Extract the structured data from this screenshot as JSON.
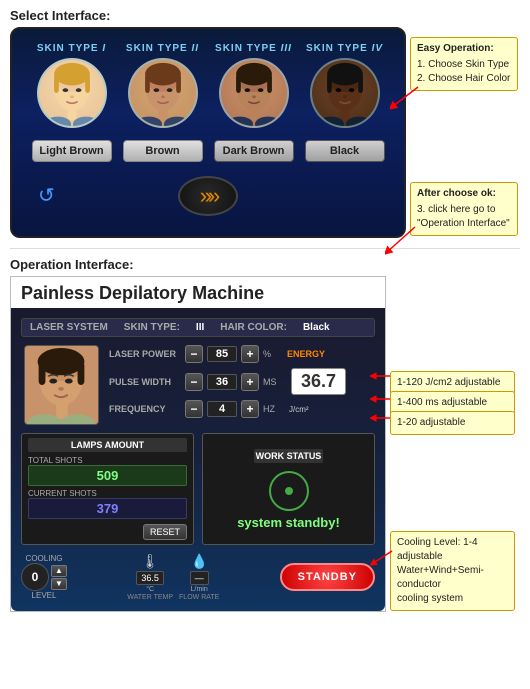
{
  "select_interface": {
    "label": "Select Interface:",
    "skin_types": [
      {
        "id": "I",
        "label": "SKIN TYPE",
        "numeral": "I",
        "face_tone": "light"
      },
      {
        "id": "II",
        "label": "SKIN TYPE",
        "numeral": "II",
        "face_tone": "medium-light"
      },
      {
        "id": "III",
        "label": "SKIN TYPE",
        "numeral": "III",
        "face_tone": "medium"
      },
      {
        "id": "IV",
        "label": "SKIN TYPE",
        "numeral": "IV",
        "face_tone": "dark"
      }
    ],
    "color_buttons": [
      {
        "id": "light-brown",
        "label": "Light Brown"
      },
      {
        "id": "brown",
        "label": "Brown"
      },
      {
        "id": "dark-brown",
        "label": "Dark Brown"
      },
      {
        "id": "black",
        "label": "Black"
      }
    ],
    "annotation_1": {
      "title": "Easy Operation:",
      "lines": [
        "1. Choose Skin Type",
        "2. Choose Hair Color"
      ]
    },
    "annotation_2": {
      "title": "After choose ok:",
      "lines": [
        "3. click here go to",
        "\"Operation Interface\""
      ]
    },
    "arrow_button": "»»"
  },
  "operation_interface": {
    "label": "Operation Interface:",
    "machine_title": "Painless Depilatory Machine",
    "header": {
      "laser_system": "LASER SYSTEM",
      "skin_type_label": "SKIN TYPE:",
      "skin_type_value": "III",
      "hair_color_label": "HAIR COLOR:",
      "hair_color_value": "Black"
    },
    "params": [
      {
        "label": "LASER POWER",
        "value": "85",
        "unit": "%"
      },
      {
        "label": "PULSE WIDTH",
        "value": "36",
        "unit": "MS"
      },
      {
        "label": "FREQUENCY",
        "value": "4",
        "unit": "HZ"
      }
    ],
    "energy": {
      "value": "36.7",
      "unit": "J/cm²",
      "label": "ENERGY"
    },
    "lamps_panel": {
      "title": "LAMPS AMOUNT",
      "total_label": "TOTAL SHOTS",
      "total_value": "509",
      "current_label": "CURRENT SHOTS",
      "current_value": "379",
      "reset_label": "RESET"
    },
    "work_panel": {
      "title": "WORK STATUS",
      "status": "system standby!"
    },
    "cooling": {
      "label": "COOLING",
      "level_label": "LEVEL",
      "level_value": "0"
    },
    "sensors": [
      {
        "icon": "🌡",
        "value": "36.5",
        "unit": "°C",
        "label": "WATER TEMP"
      },
      {
        "icon": "💨",
        "value": "—",
        "unit": "L/min",
        "label": "FLOW RATE"
      }
    ],
    "standby_btn": "STANDBY",
    "annotations": [
      {
        "text": "1-120 J/cm2 adjustable"
      },
      {
        "text": "1-400 ms adjustable"
      },
      {
        "text": "1-20 adjustable"
      }
    ],
    "annotation_cooling": {
      "lines": [
        "Cooling Level: 1-4 adjustable",
        "Water+Wind+Semi-conductor",
        "cooling system"
      ]
    }
  }
}
